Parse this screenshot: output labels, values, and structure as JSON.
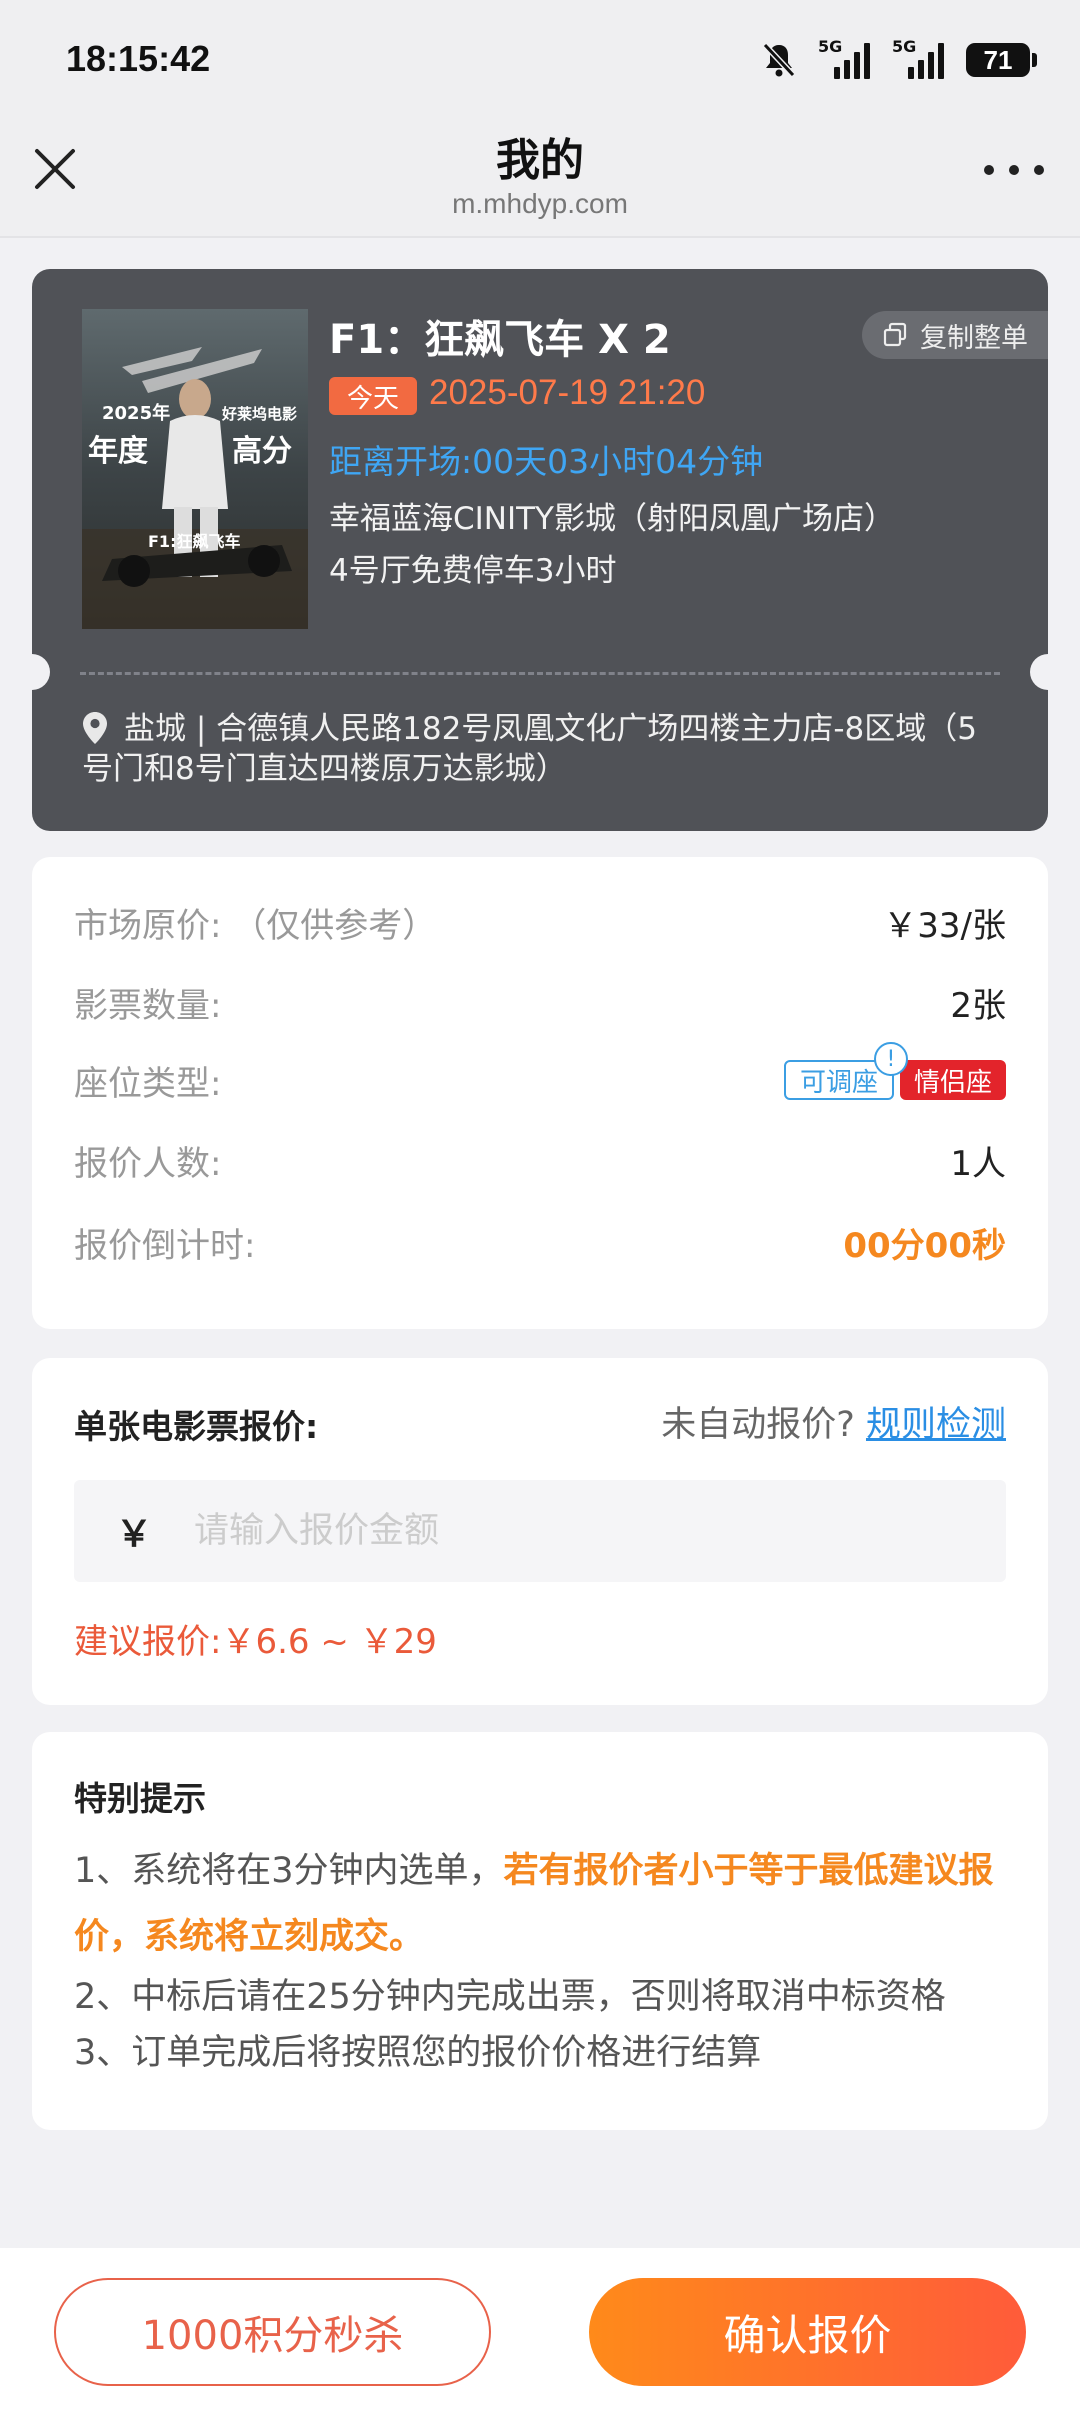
{
  "status_bar": {
    "time": "18:15:42",
    "signal1": "5G",
    "signal2": "5G",
    "battery": "71"
  },
  "header": {
    "title": "我的",
    "url": "m.mhdyp.com"
  },
  "movie": {
    "name": "F1：狂飙飞车  X 2",
    "copy_label": "复制整单",
    "today_label": "今天",
    "showtime": "2025-07-19 21:20",
    "countdown": "距离开场:00天03小时04分钟",
    "cinema": "幸福蓝海CINITY影城（射阳凤凰广场店）",
    "parking": "4号厅免费停车3小时",
    "address": "盐城 | 合德镇人民路182号凤凰文化广场四楼主力店-8区域（5号门和8号门直达四楼原万达影城）",
    "poster": {
      "line1": "2025年",
      "line2": "年度",
      "line3": "好莱坞电影",
      "line4": "高分",
      "logo": "F1",
      "cn_title": "F1:狂飙飞车"
    }
  },
  "info": {
    "market_price_label": "市场原价: （仅供参考）",
    "market_price_value": "￥33/张",
    "quantity_label": "影票数量:",
    "quantity_value": "2张",
    "seat_type_label": "座位类型:",
    "seat_tag_adjustable": "可调座",
    "seat_tag_couple": "情侣座",
    "seat_info_icon": "!",
    "bidders_label": "报价人数:",
    "bidders_value": "1人",
    "countdown_label": "报价倒计时:",
    "countdown_value": "00分00秒"
  },
  "quote": {
    "title": "单张电影票报价:",
    "auto_hint": "未自动报价?",
    "rule_link": "规则检测",
    "currency": "￥",
    "placeholder": "请输入报价金额",
    "suggest": "建议报价:￥6.6 ~ ￥29"
  },
  "tips": {
    "title": "特别提示",
    "tip1_prefix": "1、系统将在3分钟内选单，",
    "tip1_highlight": "若有报价者小于等于最低建议报价，系统将立刻成交。",
    "tip2": "2、中标后请在25分钟内完成出票，否则将取消中标资格",
    "tip3": "3、订单完成后将按照您的报价价格进行结算"
  },
  "actions": {
    "flash_sale": "1000积分秒杀",
    "confirm": "确认报价"
  },
  "colors": {
    "accent_orange": "#f5881f",
    "card_dark": "#505257",
    "link_blue": "#2a8ee4",
    "couple_red": "#e3242b"
  }
}
